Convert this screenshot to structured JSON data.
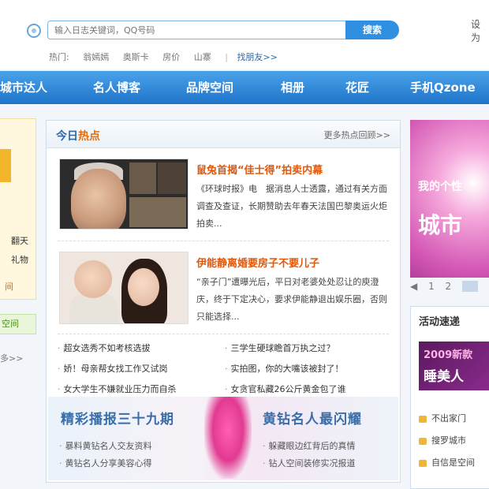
{
  "search": {
    "placeholder": "输入日志关键词，QQ号码",
    "button": "搜索"
  },
  "login": "设为",
  "hot": {
    "label": "热门:",
    "tags": [
      "翁嫣嫣",
      "奥斯卡",
      "房价",
      "山寨"
    ],
    "find_friends": "找朋友>>"
  },
  "nav": [
    "城市达人",
    "名人博客",
    "品牌空间",
    "相册",
    "花匠",
    "手机Qzone"
  ],
  "left": {
    "text1": "翻天",
    "text2": "礼物",
    "text3": "间",
    "green": "空间",
    "more": "多>>"
  },
  "hot_news": {
    "title_prefix": "今日",
    "title_highlight": "热点",
    "more": "更多热点回顾>>",
    "items": [
      {
        "headline": "鼠兔首揭“佳士得”拍卖内幕",
        "body": "《环球时报》电　据消息人士透露，通过有关方面调查及查证，长期赞助去年春天法国巴黎奥运火炬拍卖..."
      },
      {
        "headline": "伊能静离婚要房子不要儿子",
        "body": "“亲子门”遭曝光后，平日对老婆处处忍让的庾澄庆，终于下定决心，要求伊能静退出娱乐圈，否则只能选择..."
      }
    ],
    "links_left": [
      "超女选秀不如考核选拔",
      "娇！母亲帮女找工作又试岗",
      "女大学生不嫌就业压力而自杀"
    ],
    "links_right": [
      "三学生硬球瞻首万执之过？",
      "实拍图，你的大嘴该被封了！",
      "女贪官私藏26公斤黄金包了谁"
    ],
    "banner": {
      "left": "精彩播报三十九期",
      "right": "黄钻名人最闪耀",
      "links_left": [
        "暴料黄钻名人交友资料",
        "黄钻名人分享美容心得"
      ],
      "links_right": [
        "躲藏眼边红背后的真情",
        "钻人空间装修实况报道"
      ]
    }
  },
  "right": {
    "ad_line1": "我的个性",
    "ad_line2": "城市",
    "pager": [
      "1",
      "2"
    ],
    "events_title": "活动速递",
    "events_banner_1": "2009新款",
    "events_banner_2": "睡美人",
    "events_list": [
      "不出家门",
      "搜罗城市",
      "自信是空间"
    ]
  },
  "colors": {
    "nav_blue": "#2a86d9",
    "headline_orange": "#e0580c",
    "link_blue": "#2a6aa8"
  }
}
